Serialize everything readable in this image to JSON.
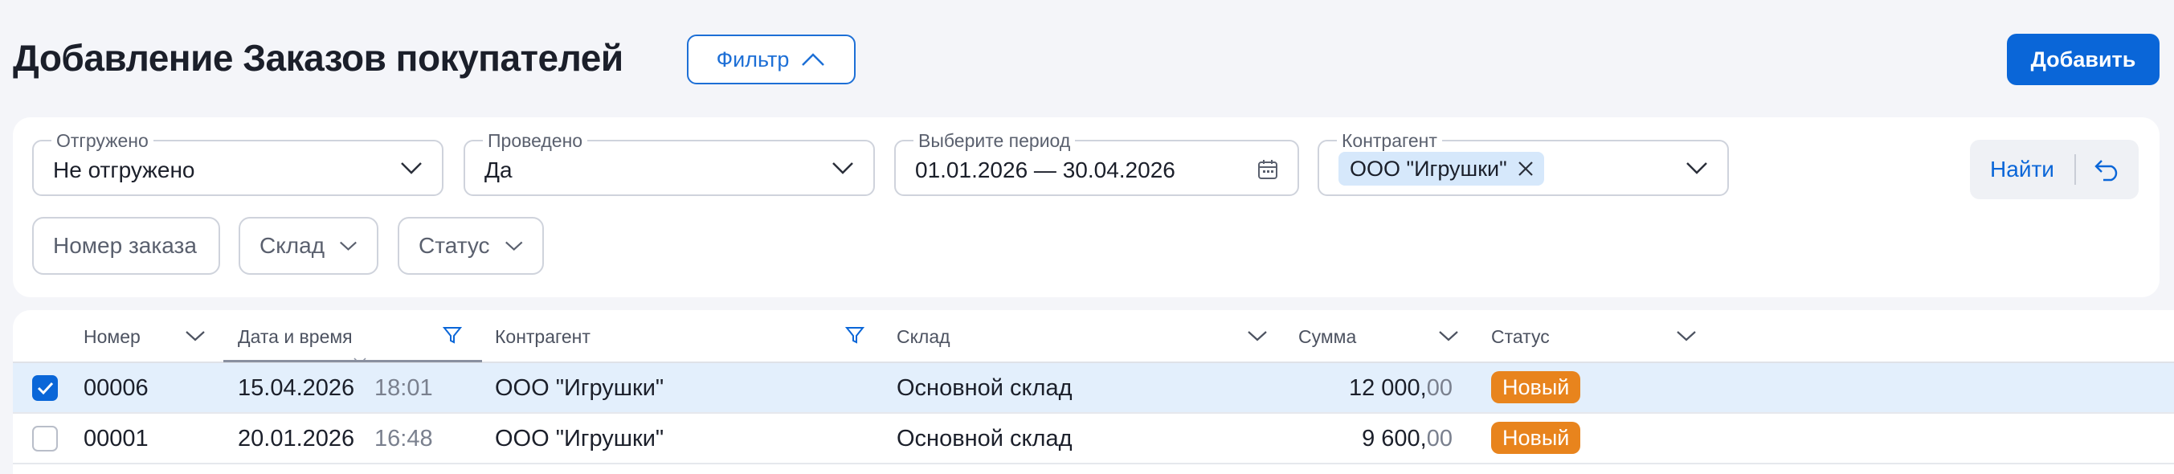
{
  "header": {
    "title": "Добавление Заказов покупателей",
    "filter_label": "Фильтр",
    "add_label": "Добавить"
  },
  "filters": {
    "shipped": {
      "legend": "Отгружено",
      "value": "Не отгружено"
    },
    "posted": {
      "legend": "Проведено",
      "value": "Да"
    },
    "period": {
      "legend": "Выберите период",
      "value": "01.01.2026 — 30.04.2026"
    },
    "counterparty": {
      "legend": "Контрагент",
      "chip": "ООО \"Игрушки\""
    },
    "find_label": "Найти",
    "order_number": "Номер заказа",
    "warehouse": "Склад",
    "status": "Статус"
  },
  "table": {
    "columns": {
      "number": "Номер",
      "datetime": "Дата и время",
      "counterparty": "Контрагент",
      "warehouse": "Склад",
      "amount": "Сумма",
      "status": "Статус"
    },
    "rows": [
      {
        "selected": true,
        "number": "00006",
        "date": "15.04.2026",
        "time": "18:01",
        "counterparty": "ООО \"Игрушки\"",
        "warehouse": "Основной склад",
        "amount_int": "12 000,",
        "amount_frac": "00",
        "status": "Новый"
      },
      {
        "selected": false,
        "number": "00001",
        "date": "20.01.2026",
        "time": "16:48",
        "counterparty": "ООО \"Игрушки\"",
        "warehouse": "Основной склад",
        "amount_int": "9 600,",
        "amount_frac": "00",
        "status": "Новый"
      }
    ]
  },
  "colors": {
    "accent": "#0a66d8",
    "selected_row": "#e3effc",
    "status_new": "#e8841d",
    "chip_bg": "#d6e8fb"
  },
  "icons": [
    "chevron-up-icon",
    "chevron-down-icon",
    "calendar-icon",
    "close-icon",
    "reset-icon",
    "filter-funnel-icon",
    "check-icon"
  ]
}
